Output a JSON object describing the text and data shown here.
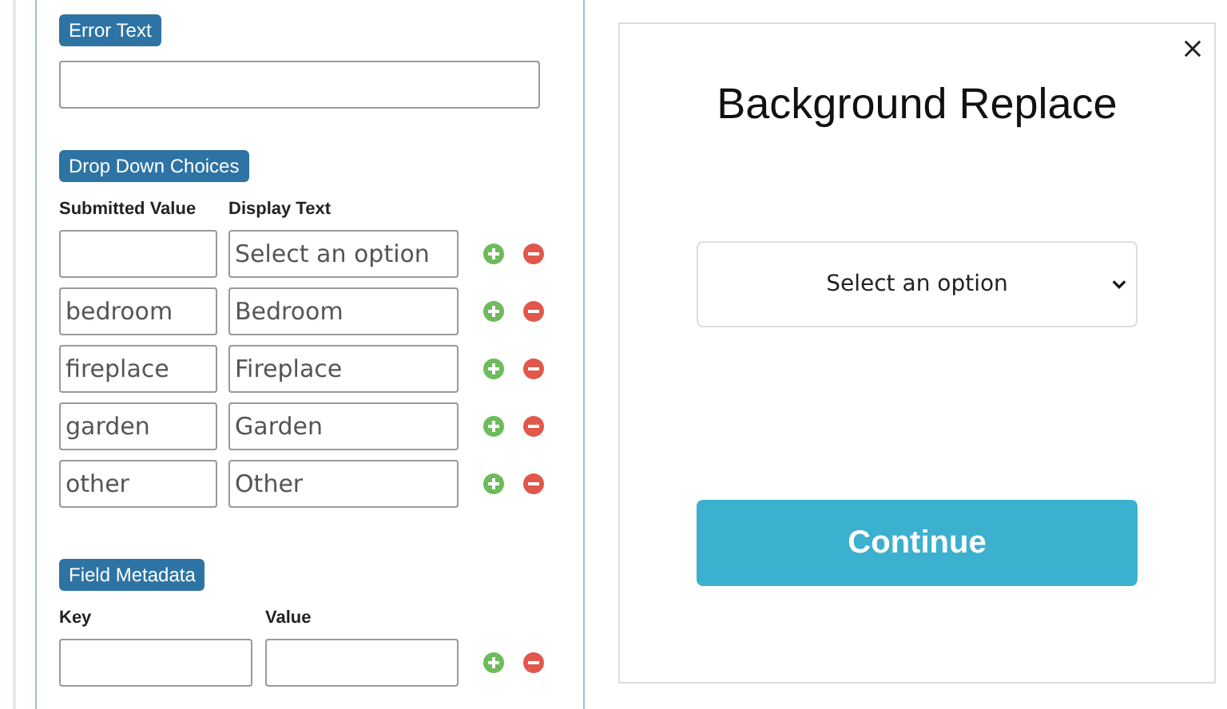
{
  "editor": {
    "error_text": {
      "label": "Error Text"
    },
    "drop_down_choices": {
      "label": "Drop Down Choices",
      "columns": [
        "Submitted Value",
        "Display Text"
      ],
      "rows": [
        {
          "submitted_value": "",
          "display_text": "Select an option"
        },
        {
          "submitted_value": "bedroom",
          "display_text": "Bedroom"
        },
        {
          "submitted_value": "fireplace",
          "display_text": "Fireplace"
        },
        {
          "submitted_value": "garden",
          "display_text": "Garden"
        },
        {
          "submitted_value": "other",
          "display_text": "Other"
        }
      ]
    },
    "field_metadata": {
      "label": "Field Metadata",
      "columns": [
        "Key",
        "Value"
      ],
      "rows": [
        {
          "key": "",
          "value": ""
        }
      ]
    }
  },
  "preview": {
    "title": "Background Replace",
    "select": {
      "value": "Select an option"
    },
    "button": "Continue"
  }
}
